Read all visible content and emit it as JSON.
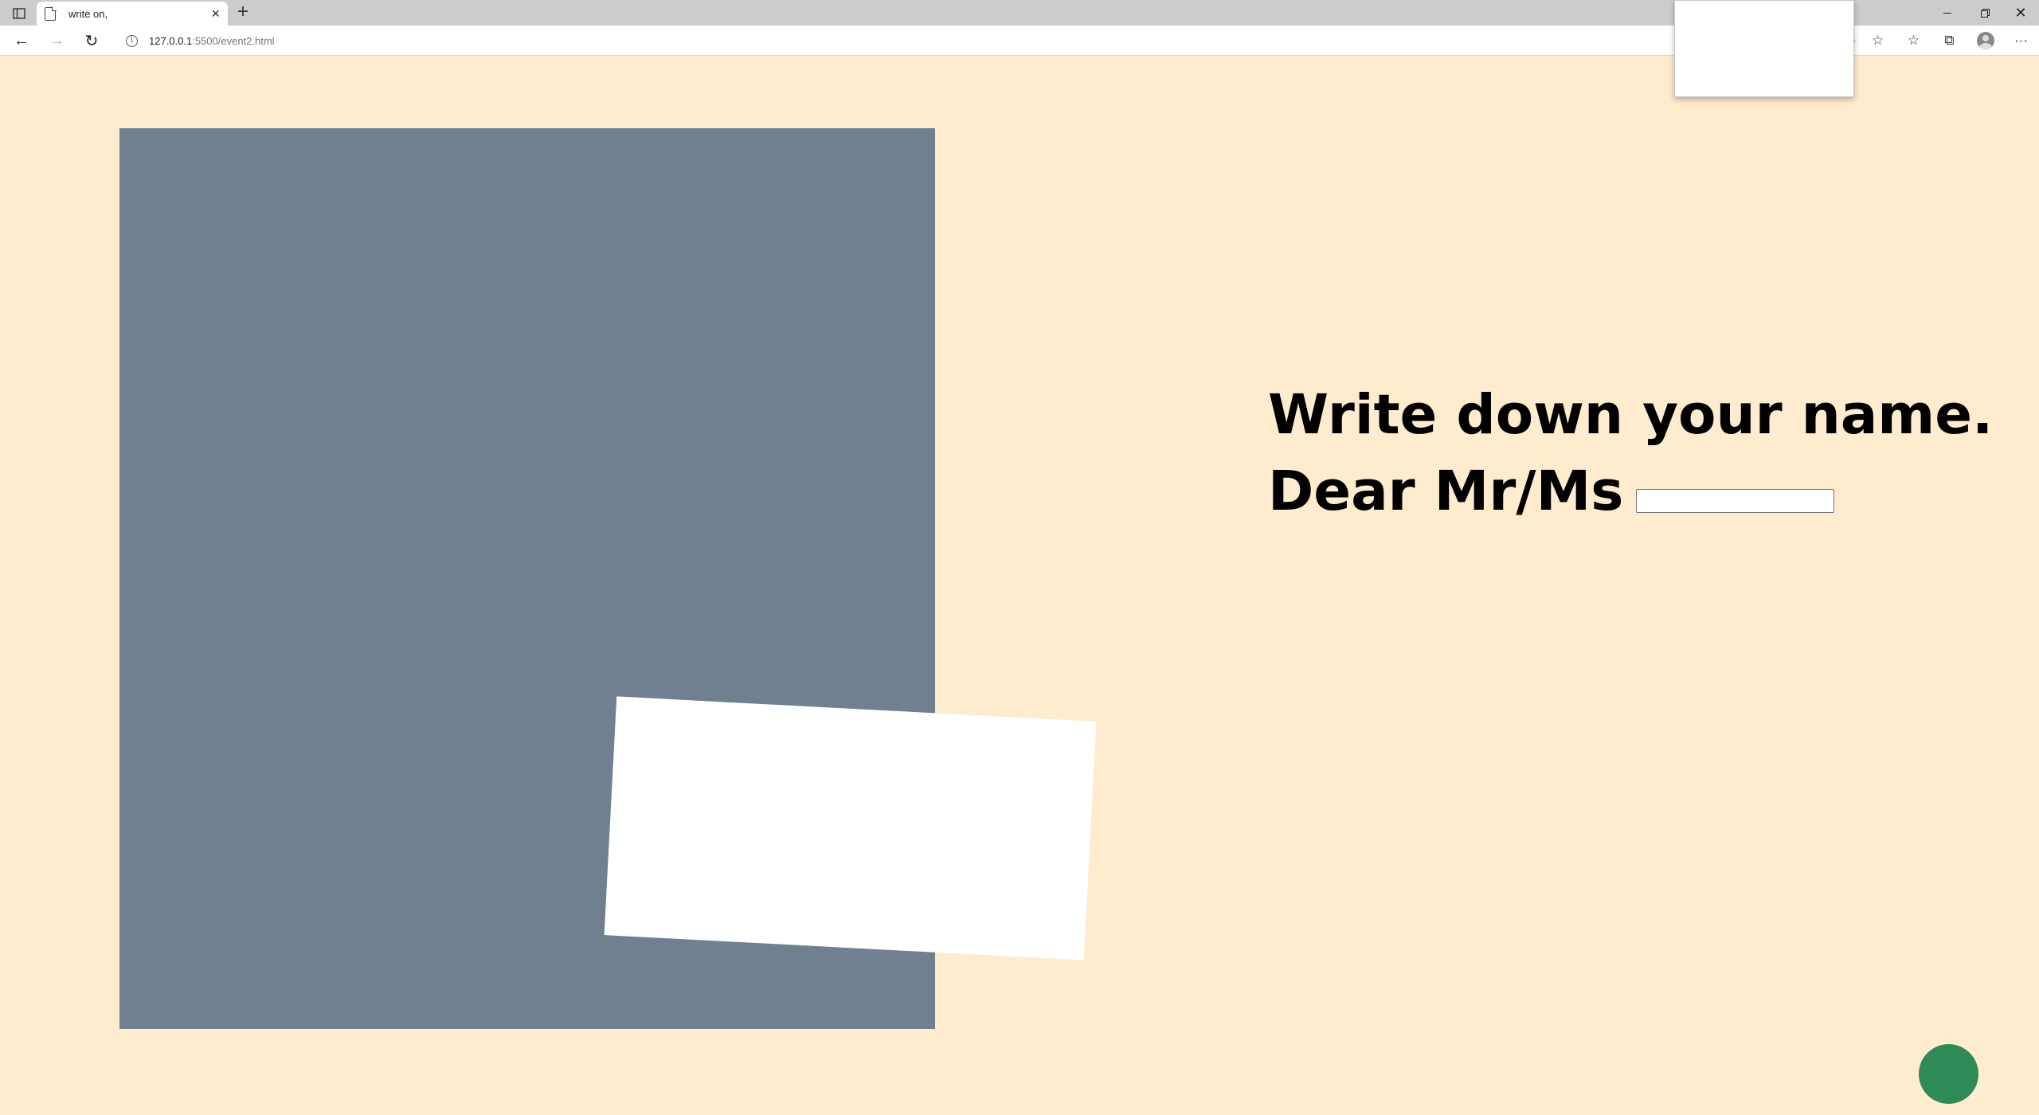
{
  "browser": {
    "tab": {
      "title": "write on,",
      "close_icon": "×"
    },
    "new_tab_icon": "+",
    "window_controls": {
      "close_icon": "✕"
    },
    "toolbar": {
      "back_icon": "←",
      "forward_icon": "→",
      "reload_icon": "↻",
      "info_icon": "i",
      "url_host": "127.0.0.1",
      "url_rest": ":5500/event2.html",
      "zoom_icon": "⊕",
      "favorites_add_icon": "☆",
      "favorites_icon": "☆",
      "collections_icon": "⧉",
      "more_icon": "···"
    }
  },
  "page": {
    "heading_line1": "Write down your name.",
    "heading_line2": "Dear Mr/Ms",
    "name_input_value": "",
    "colors": {
      "background": "#ffebcd",
      "panel": "#708090",
      "card": "#ffffff",
      "circle": "#2e8b57"
    }
  }
}
